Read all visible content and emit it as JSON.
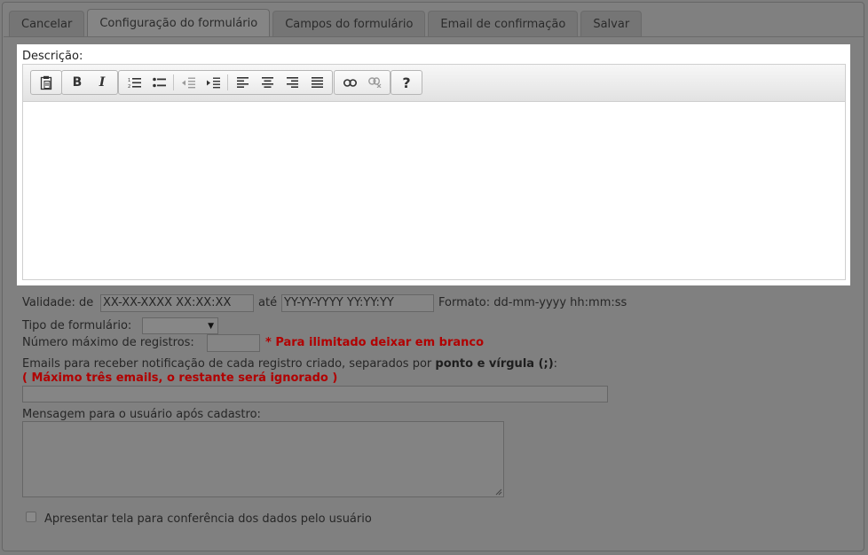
{
  "tabs": [
    {
      "label": "Cancelar"
    },
    {
      "label": "Configuração do formulário"
    },
    {
      "label": "Campos do formulário"
    },
    {
      "label": "Email de confirmação"
    },
    {
      "label": "Salvar"
    }
  ],
  "editor": {
    "label": "Descrição:",
    "content": "",
    "toolbar": {
      "bold": "B",
      "italic": "I",
      "help": "?"
    }
  },
  "form": {
    "validity_label": "Validade: de",
    "validity_from": "XX-XX-XXXX XX:XX:XX",
    "validity_until_label": "até",
    "validity_to": "YY-YY-YYYY YY:YY:YY",
    "format_text": "Formato: dd-mm-yyyy hh:mm:ss",
    "type_label": "Tipo de formulário:",
    "type_selected": "",
    "max_records_label": "Número máximo de registros:",
    "max_records_value": "",
    "max_records_hint": "* Para ilimitado deixar em branco",
    "emails_label": "Emails para receber notificação de cada registro criado, separados por",
    "emails_label_bold": "ponto e vírgula (;)",
    "emails_label_end": ":",
    "emails_hint": "( Máximo três emails, o restante será ignorado )",
    "emails_value": "",
    "message_label": "Mensagem para o usuário após cadastro:",
    "message_value": "",
    "confirm_label": "Apresentar tela para conferência dos dados pelo usuário",
    "confirm_checked": false
  }
}
